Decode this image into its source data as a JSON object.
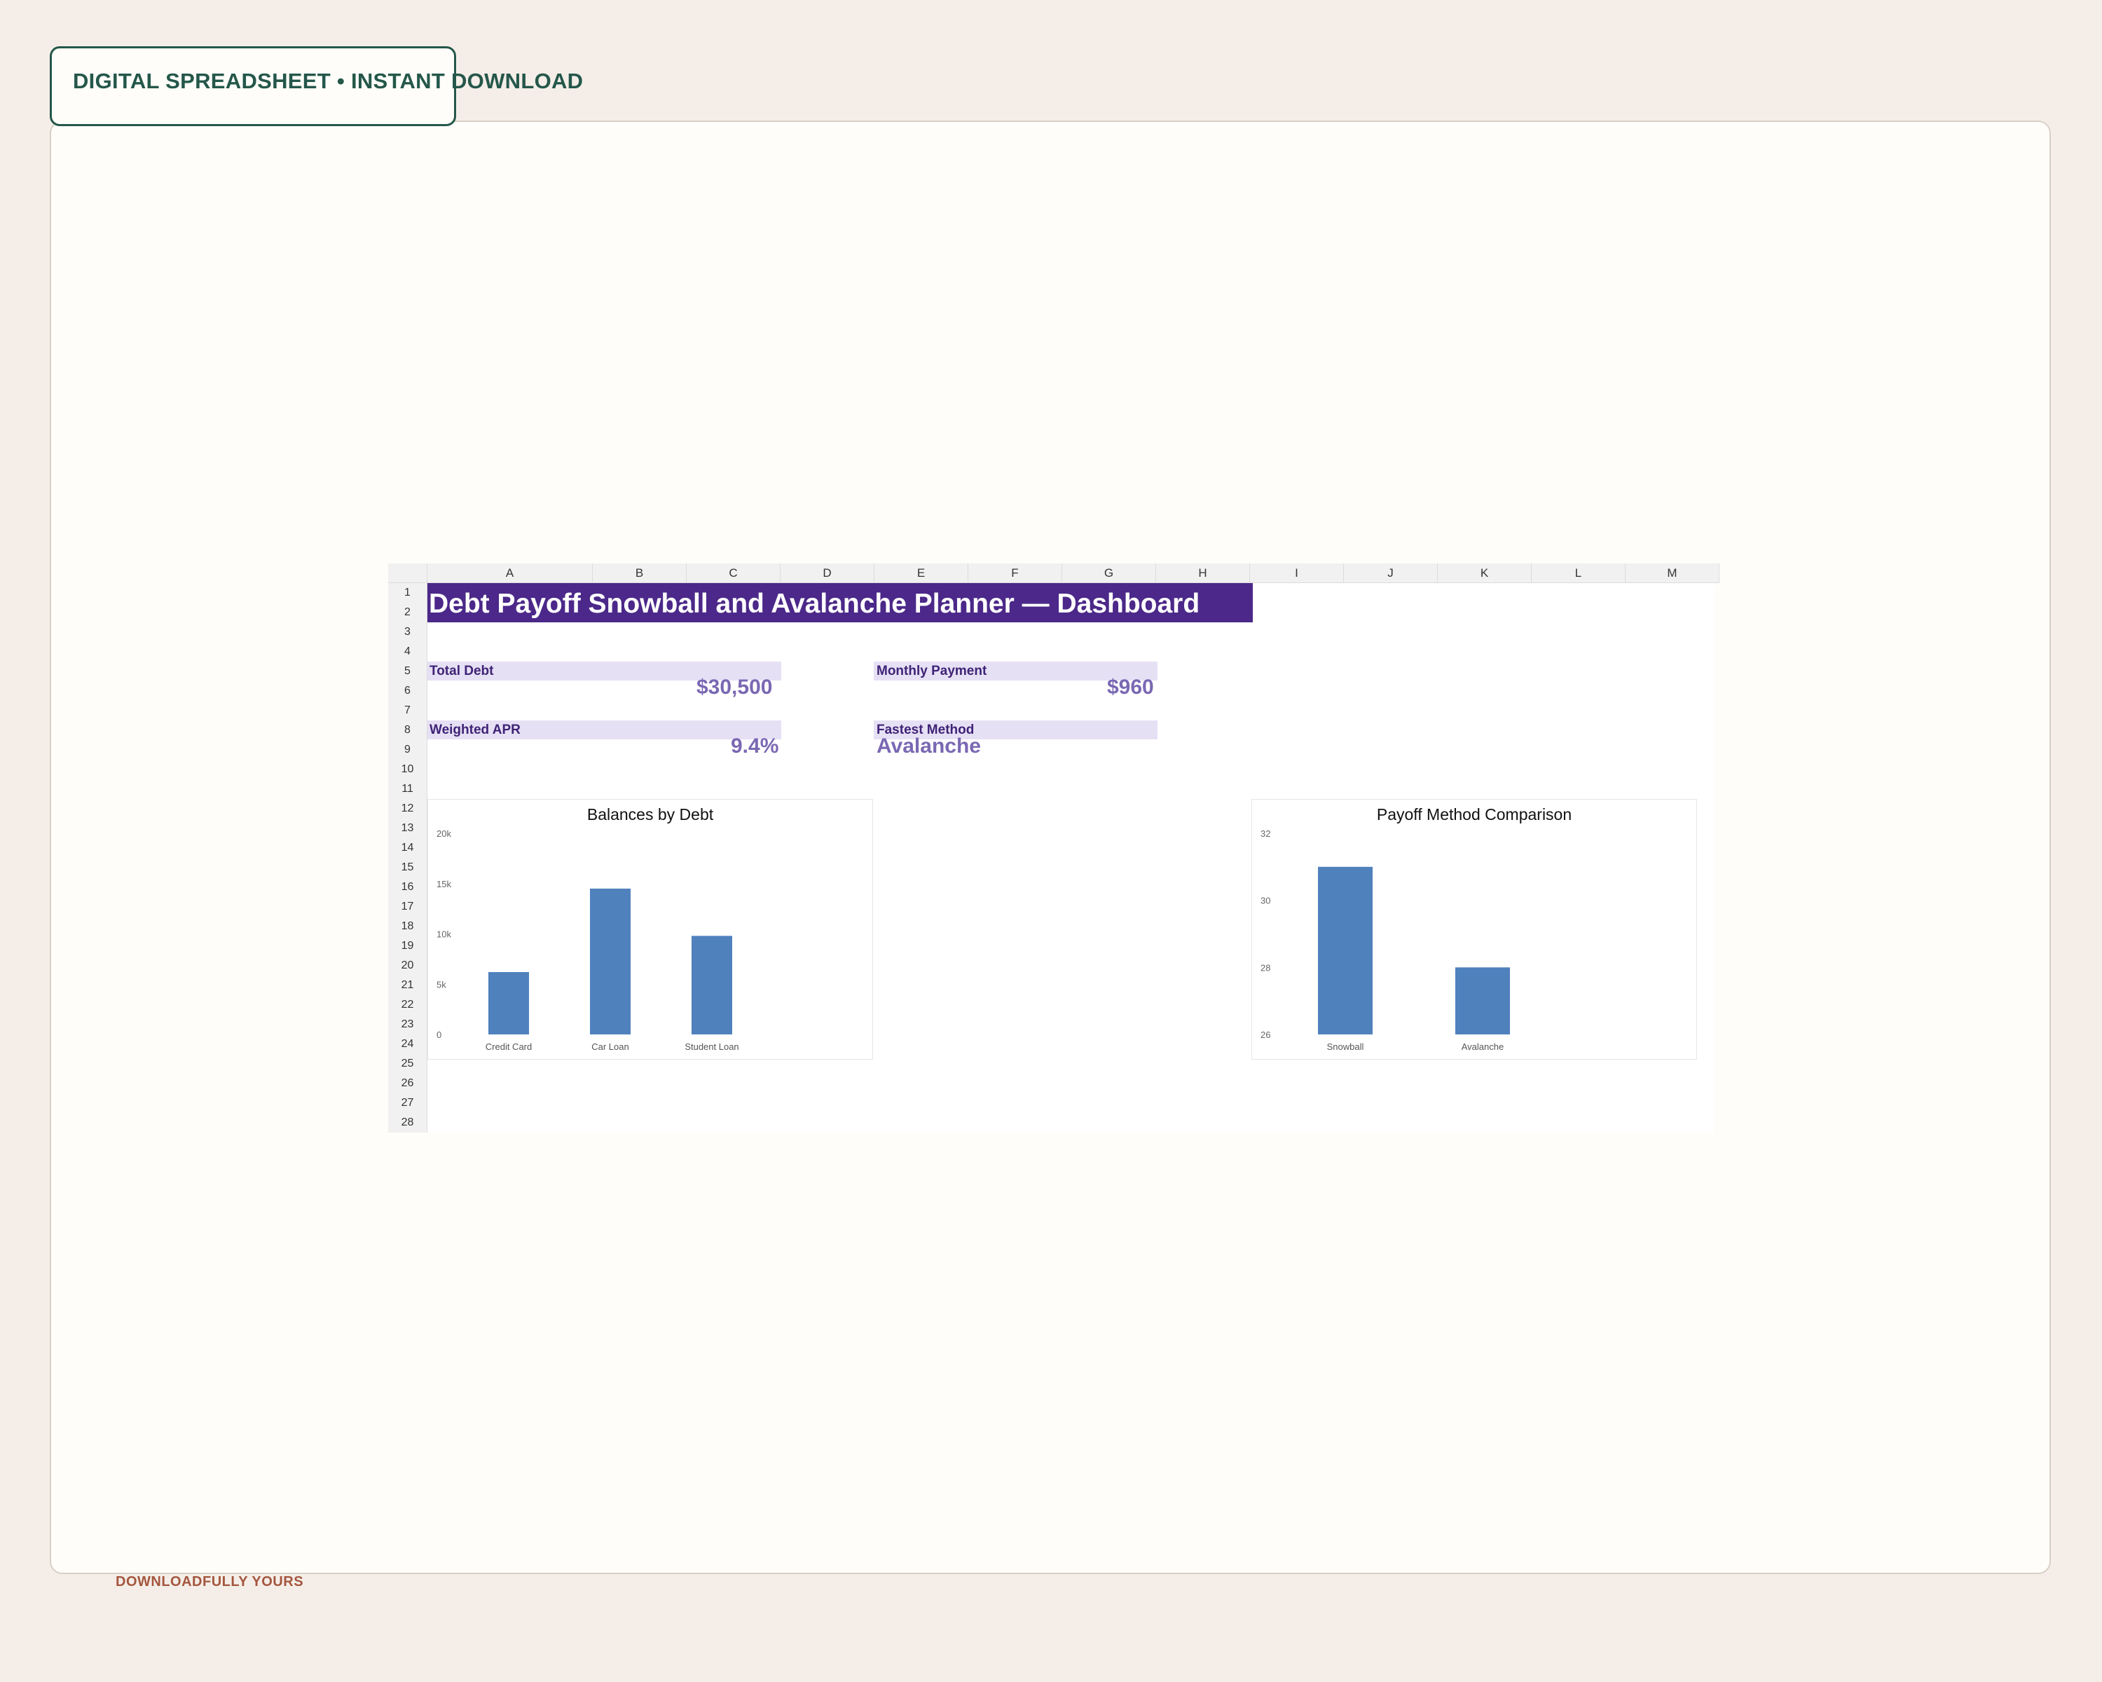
{
  "badge": {
    "text": "DIGITAL SPREADSHEET • INSTANT DOWNLOAD"
  },
  "footer": {
    "text": "DOWNLOADFULLY YOURS"
  },
  "sheet": {
    "columns": [
      "A",
      "B",
      "C",
      "D",
      "E",
      "F",
      "G",
      "H",
      "I",
      "J",
      "K",
      "L",
      "M"
    ],
    "rows": [
      "1",
      "2",
      "3",
      "4",
      "5",
      "6",
      "7",
      "8",
      "9",
      "10",
      "11",
      "12",
      "13",
      "14",
      "15",
      "16",
      "17",
      "18",
      "19",
      "20",
      "21",
      "22",
      "23",
      "24",
      "25",
      "26",
      "27",
      "28"
    ],
    "title": "Debt Payoff Snowball and Avalanche Planner — Dashboard",
    "kpis": {
      "total_debt_label": "Total Debt",
      "total_debt_value": "$30,500",
      "monthly_payment_label": "Monthly Payment",
      "monthly_payment_value": "$960",
      "weighted_apr_label": "Weighted APR",
      "weighted_apr_value": "9.4%",
      "fastest_method_label": "Fastest Method",
      "fastest_method_value": "Avalanche"
    }
  },
  "colors": {
    "title_bg": "#4b2889",
    "kpi_label_bg": "#e6e0f5",
    "bar": "#4f81bd",
    "kpi_value": "#7a68b3"
  },
  "chart_data": [
    {
      "type": "bar",
      "title": "Balances by Debt",
      "categories": [
        "Credit Card",
        "Car Loan",
        "Student Loan"
      ],
      "values": [
        6200,
        14500,
        9800
      ],
      "ylim": [
        0,
        20000
      ],
      "yticks": [
        0,
        5000,
        10000,
        15000,
        20000
      ],
      "ytick_labels": [
        "0",
        "5k",
        "10k",
        "15k",
        "20k"
      ],
      "xlabel": "",
      "ylabel": "",
      "grid": false,
      "legend": "none"
    },
    {
      "type": "bar",
      "title": "Payoff Method Comparison",
      "categories": [
        "Snowball",
        "Avalanche"
      ],
      "values": [
        31,
        28
      ],
      "ylim": [
        26,
        32
      ],
      "yticks": [
        26,
        28,
        30,
        32
      ],
      "ytick_labels": [
        "26",
        "28",
        "30",
        "32"
      ],
      "xlabel": "",
      "ylabel": "",
      "grid": false,
      "legend": "none"
    }
  ]
}
